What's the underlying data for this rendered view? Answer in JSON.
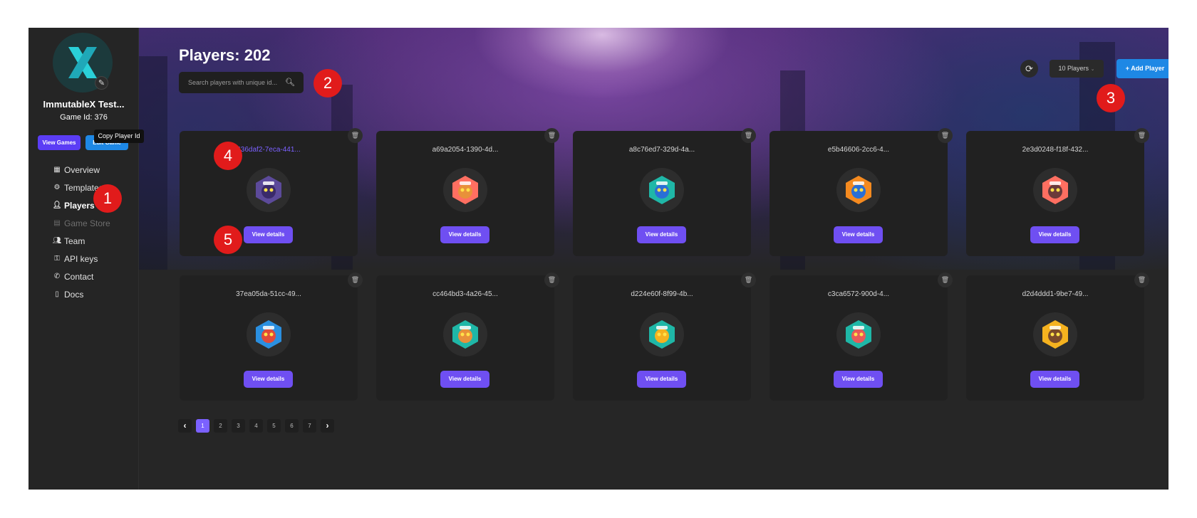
{
  "sidebar": {
    "game_name": "ImmutableX Test...",
    "game_id": "Game Id: 376",
    "view_games": "View Games",
    "edit_game": "Edit Game",
    "nav": [
      {
        "label": "Overview",
        "icon": "dashboard-icon",
        "state": "normal"
      },
      {
        "label": "Templates",
        "icon": "templates-icon",
        "state": "normal"
      },
      {
        "label": "Players",
        "icon": "user-icon",
        "state": "active"
      },
      {
        "label": "Game Store",
        "icon": "store-icon",
        "state": "disabled"
      },
      {
        "label": "Team",
        "icon": "team-icon",
        "state": "normal"
      },
      {
        "label": "API keys",
        "icon": "key-icon",
        "state": "normal"
      },
      {
        "label": "Contact",
        "icon": "phone-icon",
        "state": "normal"
      },
      {
        "label": "Docs",
        "icon": "document-icon",
        "state": "normal"
      }
    ]
  },
  "header": {
    "title": "Players: 202",
    "search_placeholder": "Search players with unique id...",
    "per_page": "10 Players",
    "add_player": "+ Add Player"
  },
  "tooltip": "Copy Player Id",
  "players": [
    {
      "id": "436daf2-7eca-441...",
      "details": "View details",
      "hex": "#5c4a9a",
      "body": "#3a2a6a"
    },
    {
      "id": "a69a2054-1390-4d...",
      "details": "View details",
      "hex": "#ff6f61",
      "body": "#e8913a"
    },
    {
      "id": "a8c76ed7-329d-4a...",
      "details": "View details",
      "hex": "#1fb7a7",
      "body": "#2a6fd6"
    },
    {
      "id": "e5b46606-2cc6-4...",
      "details": "View details",
      "hex": "#f58a1f",
      "body": "#2a6fd6"
    },
    {
      "id": "2e3d0248-f18f-432...",
      "details": "View details",
      "hex": "#ff6f61",
      "body": "#6a3a3a"
    },
    {
      "id": "37ea05da-51cc-49...",
      "details": "View details",
      "hex": "#2a8fe0",
      "body": "#e04a3a"
    },
    {
      "id": "cc464bd3-4a26-45...",
      "details": "View details",
      "hex": "#1fb7a7",
      "body": "#e8913a"
    },
    {
      "id": "d224e60f-8f99-4b...",
      "details": "View details",
      "hex": "#1fb7a7",
      "body": "#f5b21f"
    },
    {
      "id": "c3ca6572-900d-4...",
      "details": "View details",
      "hex": "#1fb7a7",
      "body": "#e85a5a"
    },
    {
      "id": "d2d4ddd1-9be7-49...",
      "details": "View details",
      "hex": "#f5b21f",
      "body": "#7a4a2a"
    }
  ],
  "pagination": {
    "pages": [
      "1",
      "2",
      "3",
      "4",
      "5",
      "6",
      "7"
    ],
    "current": "1",
    "prev": "‹",
    "next": "›"
  },
  "markers": [
    "1",
    "2",
    "3",
    "4",
    "5"
  ],
  "colors": {
    "accent": "#6f4ff2",
    "primary_blue": "#1e88e5",
    "marker_red": "#e11b1b"
  }
}
